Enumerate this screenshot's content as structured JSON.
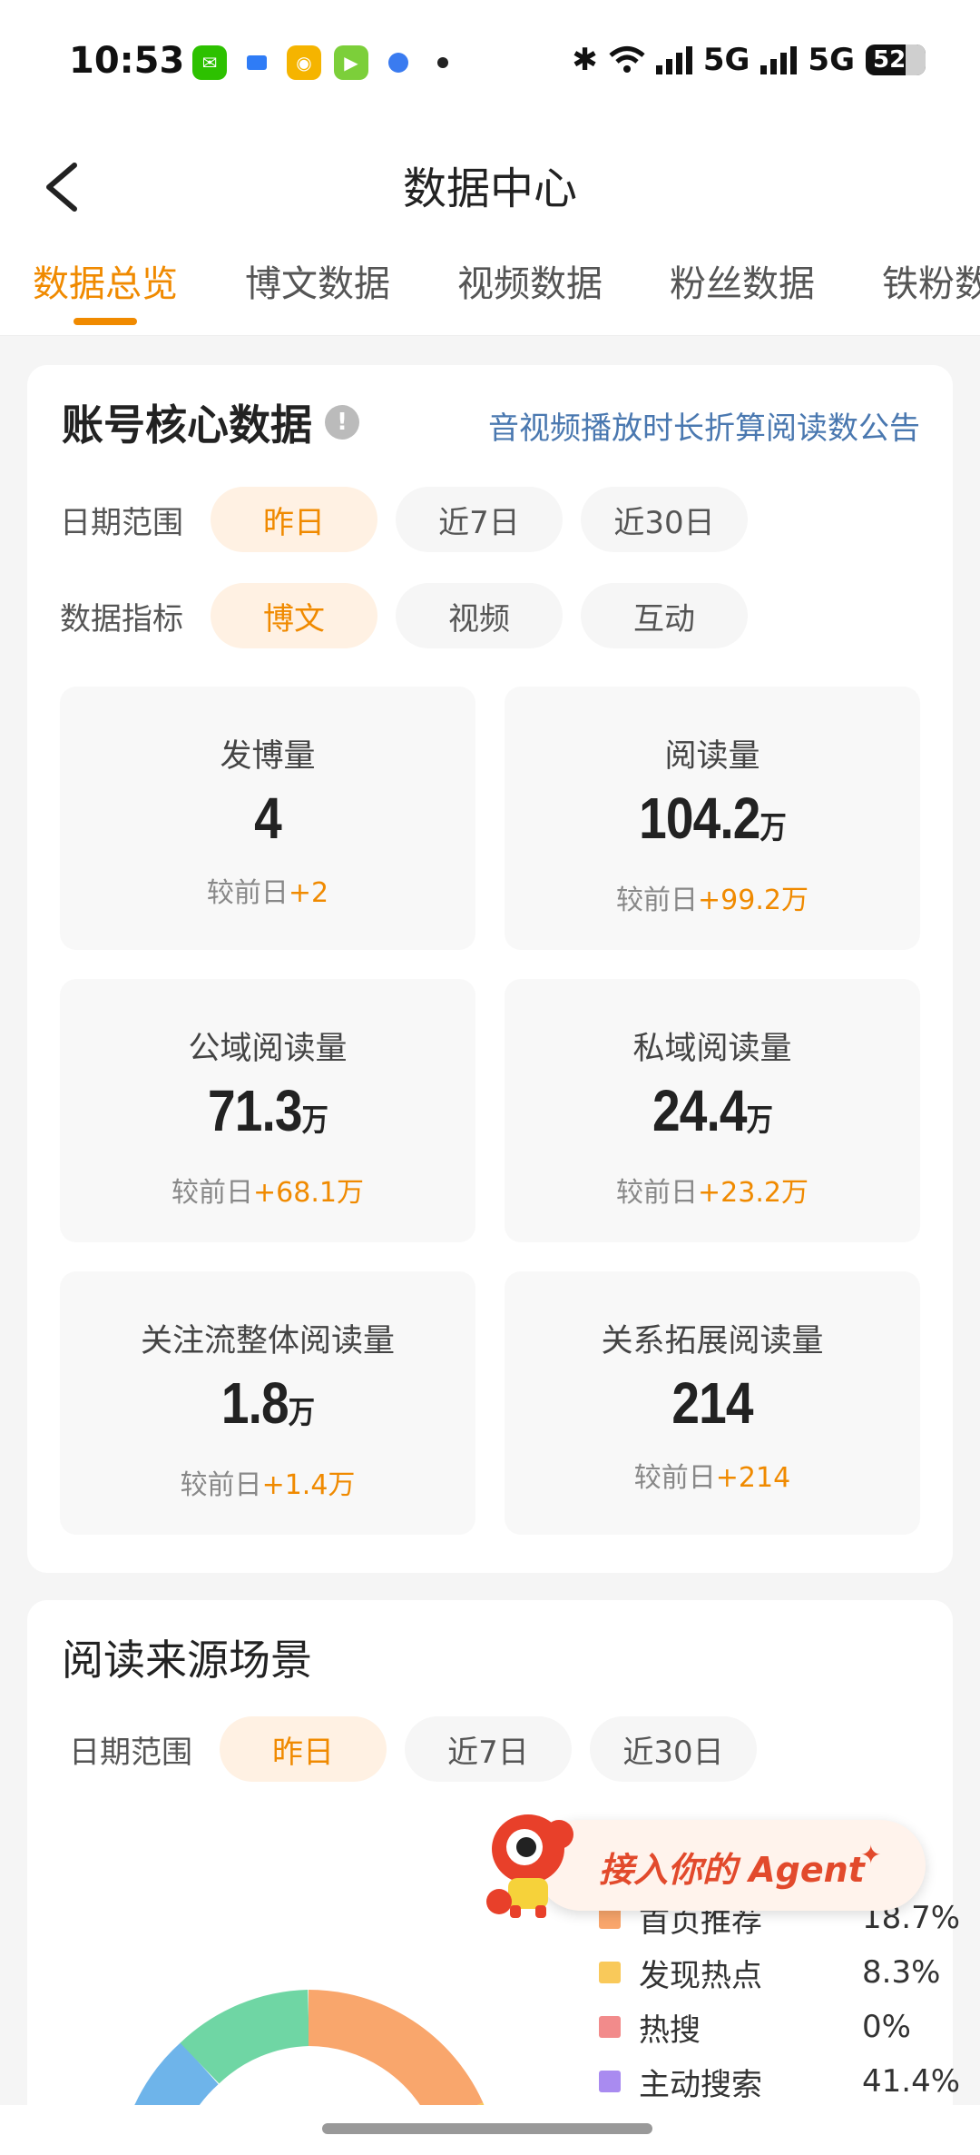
{
  "status": {
    "time": "10:53",
    "network1": "5G",
    "network2": "5G",
    "battery": "52"
  },
  "nav": {
    "title": "数据中心",
    "tabs": [
      "数据总览",
      "博文数据",
      "视频数据",
      "粉丝数据",
      "铁粉数据"
    ]
  },
  "core": {
    "title": "账号核心数据",
    "notice": "音视频播放时长折算阅读数公告",
    "date_label": "日期范围",
    "date_options": [
      "昨日",
      "近7日",
      "近30日"
    ],
    "metric_label": "数据指标",
    "metric_options": [
      "博文",
      "视频",
      "互动"
    ],
    "delta_prefix": "较前日",
    "metrics": [
      {
        "label": "发博量",
        "value": "4",
        "unit": "",
        "delta": "+2"
      },
      {
        "label": "阅读量",
        "value": "104.2",
        "unit": "万",
        "delta": "+99.2万"
      },
      {
        "label": "公域阅读量",
        "value": "71.3",
        "unit": "万",
        "delta": "+68.1万"
      },
      {
        "label": "私域阅读量",
        "value": "24.4",
        "unit": "万",
        "delta": "+23.2万"
      },
      {
        "label": "关注流整体阅读量",
        "value": "1.8",
        "unit": "万",
        "delta": "+1.4万"
      },
      {
        "label": "关系拓展阅读量",
        "value": "214",
        "unit": "",
        "delta": "+214"
      }
    ]
  },
  "source": {
    "title": "阅读来源场景",
    "date_label": "日期范围",
    "date_options": [
      "昨日",
      "近7日",
      "近30日"
    ],
    "legend": [
      {
        "name": "首页推荐",
        "pct": "18.7%",
        "color": "#f9a66c"
      },
      {
        "name": "发现热点",
        "pct": "8.3%",
        "color": "#f9c95a"
      },
      {
        "name": "热搜",
        "pct": "0%",
        "color": "#f28b8b"
      },
      {
        "name": "主动搜索",
        "pct": "41.4%",
        "color": "#a98bf0"
      }
    ]
  },
  "agent": {
    "label": "接入你的 Agent"
  }
}
